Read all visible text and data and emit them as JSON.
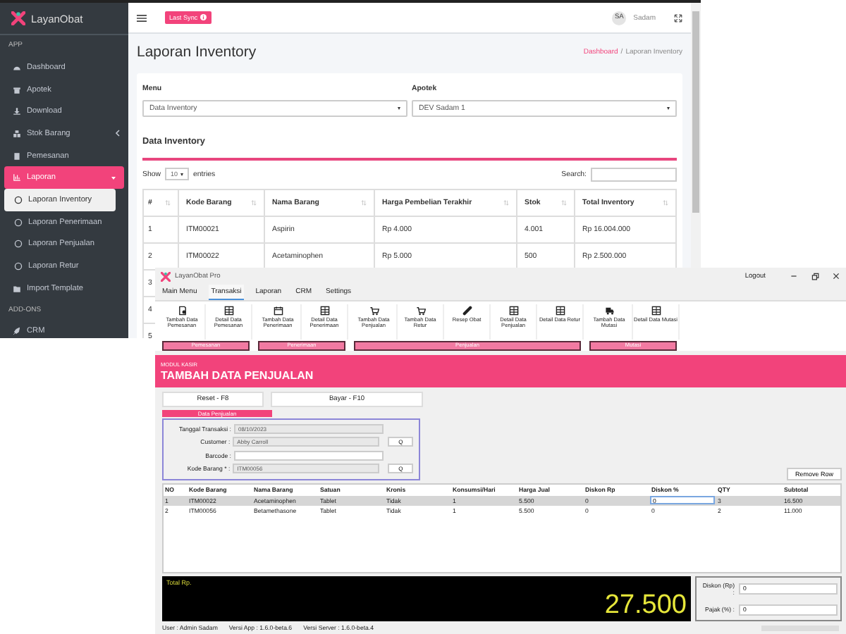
{
  "web": {
    "brand": "LayanObat",
    "sidebar": [
      {
        "kind": "header",
        "label": "APP"
      },
      {
        "kind": "item",
        "label": "Dashboard",
        "selected": false
      },
      {
        "kind": "item",
        "label": "Apotek",
        "selected": false
      },
      {
        "kind": "item",
        "label": "Download",
        "selected": false
      },
      {
        "kind": "item",
        "label": "Stok Barang",
        "selected": false,
        "expanded": false
      },
      {
        "kind": "item",
        "label": "Pemesanan",
        "selected": false
      },
      {
        "kind": "item",
        "label": "Laporan",
        "selected": true,
        "expanded": true
      },
      {
        "kind": "subitem",
        "label": "Laporan Inventory",
        "selected": true
      },
      {
        "kind": "subitem",
        "label": "Laporan Penerimaan",
        "selected": false
      },
      {
        "kind": "subitem",
        "label": "Laporan Penjualan",
        "selected": false
      },
      {
        "kind": "subitem",
        "label": "Laporan Retur",
        "selected": false
      },
      {
        "kind": "item",
        "label": "Import Template",
        "selected": false
      },
      {
        "kind": "header",
        "label": "ADD-ONS"
      },
      {
        "kind": "item",
        "label": "CRM",
        "selected": false
      }
    ],
    "sync_button": "Last Sync",
    "user": {
      "initials": "SA",
      "name": "Sadam"
    },
    "page_title": "Laporan Inventory",
    "breadcrumb": [
      "Dashboard",
      "Laporan Inventory"
    ],
    "breadcrumb_separator": "/",
    "filters": [
      {
        "label": "Menu",
        "value": "Data Inventory"
      },
      {
        "label": "Apotek",
        "value": "DEV Sadam 1"
      }
    ],
    "section_title": "Data Inventory",
    "show_label": "Show",
    "page_size": "10",
    "entries_label": "entries",
    "search_label": "Search:",
    "table": {
      "columns": [
        "#",
        "Kode Barang",
        "Nama Barang",
        "Harga Pembelian Terakhir",
        "Stok",
        "Total Inventory"
      ],
      "rows": [
        [
          "1",
          "ITM00021",
          "Aspirin",
          "Rp 4.000",
          "4.001",
          "Rp 16.004.000"
        ],
        [
          "2",
          "ITM00022",
          "Acetaminophen",
          "Rp 5.000",
          "500",
          "Rp 2.500.000"
        ],
        [
          "3"
        ],
        [
          "4"
        ],
        [
          "5"
        ]
      ]
    }
  },
  "app": {
    "title": "LayanObat Pro",
    "logout": "Logout",
    "tabs": [
      {
        "label": "Main Menu",
        "selected": false
      },
      {
        "label": "Transaksi",
        "selected": true
      },
      {
        "label": "Laporan",
        "selected": false
      },
      {
        "label": "CRM",
        "selected": false
      },
      {
        "label": "Settings",
        "selected": false
      }
    ],
    "ribbon": [
      {
        "group": "Pemesanan",
        "buttons": [
          "Tambah Data Pemesanan",
          "Detail Data Pemesanan"
        ]
      },
      {
        "group": "Penerimaan",
        "buttons": [
          "Tambah Data Penerimaan",
          "Detail Data Penerimaan"
        ]
      },
      {
        "group": "Penjualan",
        "buttons": [
          "Tambah Data Penjualan",
          "Tambah Data Retur",
          "Resep Obat",
          "Detail Data Penjualan",
          "Detail Data Retur"
        ]
      },
      {
        "group": "Mutasi",
        "buttons": [
          "Tambah Data Mutasi",
          "Detail Data Mutasi"
        ]
      }
    ],
    "module": "MODUL KASIR",
    "heading": "TAMBAH DATA PENJUALAN",
    "actions": [
      "Reset - F8",
      "Bayar - F10"
    ],
    "form_title": "Data Penjualan",
    "fields": [
      {
        "label": "Tanggal Transaksi :",
        "value": "08/10/2023",
        "disabled": true
      },
      {
        "label": "Customer :",
        "value": "Abby Carroll",
        "disabled": true,
        "lookup": "Q"
      },
      {
        "label": "Barcode :",
        "disabled": false
      },
      {
        "label": "Kode Barang * :",
        "value": "ITM00056",
        "disabled": true,
        "lookup": "Q"
      }
    ],
    "remove_button": "Remove Row",
    "columns": [
      {
        "label": "NO",
        "editable": false
      },
      {
        "label": "Kode Barang",
        "editable": false
      },
      {
        "label": "Nama Barang",
        "editable": false
      },
      {
        "label": "Satuan",
        "editable": false
      },
      {
        "label": "Kronis",
        "editable": false
      },
      {
        "label": "Konsumsi/Hari",
        "editable": false
      },
      {
        "label": "Harga Jual",
        "editable": false
      },
      {
        "label": "Diskon Rp",
        "editable": false
      },
      {
        "label": "Diskon %",
        "editable": true
      },
      {
        "label": "QTY",
        "editable": false
      },
      {
        "label": "Subtotal",
        "editable": false
      }
    ],
    "rows": [
      {
        "selected": true,
        "editing": true,
        "cells": [
          "1",
          "ITM00022",
          "Acetaminophen",
          "Tablet",
          "Tidak",
          "1",
          "5.500",
          "0",
          "0",
          "3",
          "16.500"
        ]
      },
      {
        "selected": false,
        "editing": false,
        "cells": [
          "2",
          "ITM00056",
          "Betamethasone",
          "Tablet",
          "Tidak",
          "1",
          "5.500",
          "0",
          "0",
          "2",
          "11.000"
        ]
      }
    ],
    "total_label": "Total Rp.",
    "total": "27.500",
    "summary": [
      {
        "label": "Diskon (Rp) :",
        "value": "0"
      },
      {
        "label": "Pajak (%) :",
        "value": "0"
      }
    ],
    "status": [
      "User : Admin Sadam",
      "Versi App : 1.6.0-beta.6",
      "Versi Server : 1.6.0-beta.4"
    ]
  }
}
